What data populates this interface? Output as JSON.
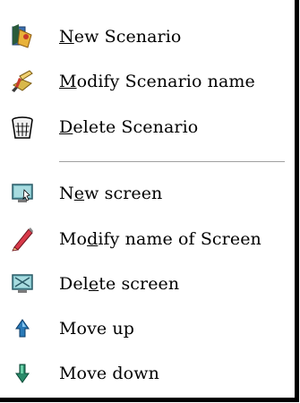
{
  "menu": {
    "items": [
      {
        "pre": "",
        "key": "N",
        "post": "ew Scenario",
        "icon": "new-scenario-icon"
      },
      {
        "pre": "",
        "key": "M",
        "post": "odify Scenario name",
        "icon": "modify-scenario-icon"
      },
      {
        "pre": "",
        "key": "D",
        "post": "elete Scenario",
        "icon": "delete-scenario-icon"
      },
      {
        "pre": "N",
        "key": "e",
        "post": "w screen",
        "icon": "new-screen-icon"
      },
      {
        "pre": "Mo",
        "key": "d",
        "post": "ify name of Screen",
        "icon": "pencil-icon"
      },
      {
        "pre": "Del",
        "key": "e",
        "post": "te screen",
        "icon": "delete-screen-icon"
      },
      {
        "pre": "Move up",
        "key": "",
        "post": "",
        "icon": "arrow-up-icon"
      },
      {
        "pre": "Move down",
        "key": "",
        "post": "",
        "icon": "arrow-down-icon"
      }
    ]
  }
}
